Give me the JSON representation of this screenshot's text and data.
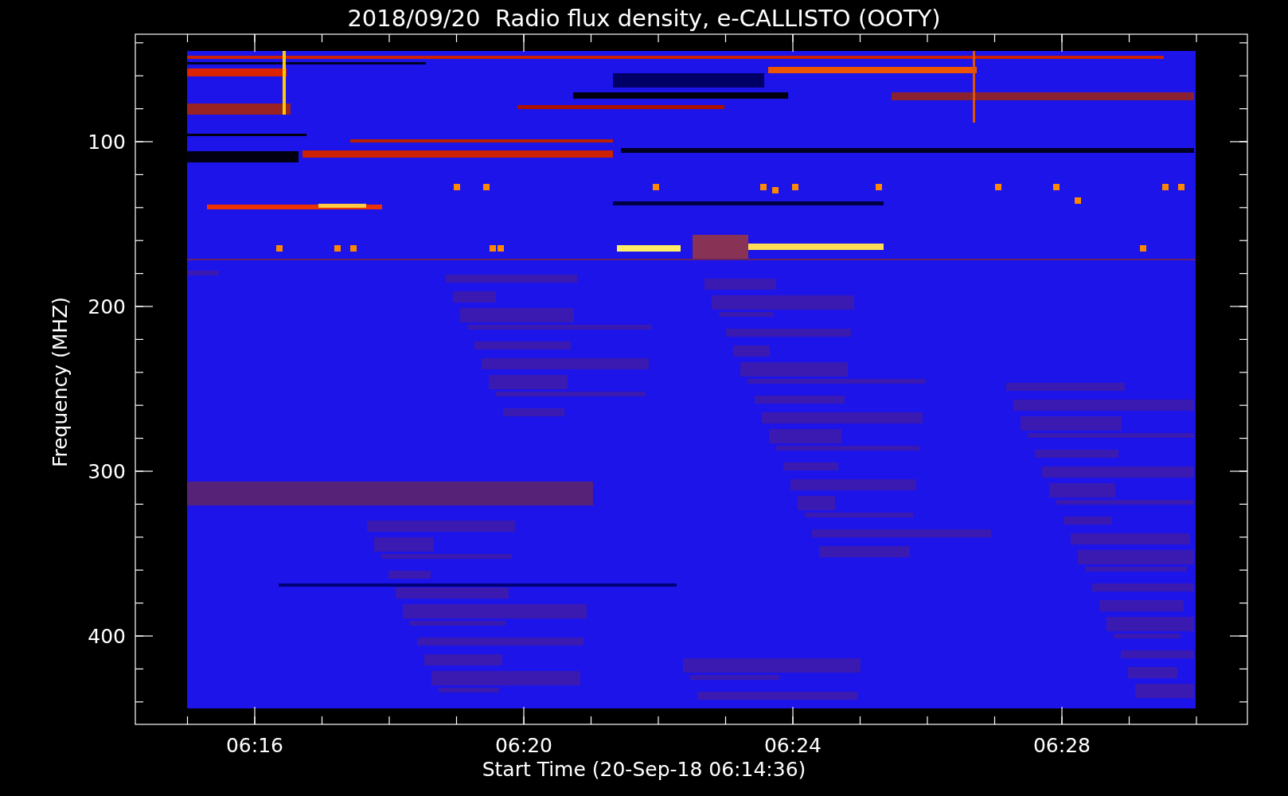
{
  "title": "2018/09/20  Radio flux density, e-CALLISTO (OOTY)",
  "y_axis": {
    "label": "Frequency (MHZ)",
    "ticks": [
      "100",
      "200",
      "300",
      "400"
    ]
  },
  "x_axis": {
    "label": "Start Time (20-Sep-18 06:14:36)",
    "ticks": [
      "06:16",
      "06:20",
      "06:24",
      "06:28"
    ]
  }
}
